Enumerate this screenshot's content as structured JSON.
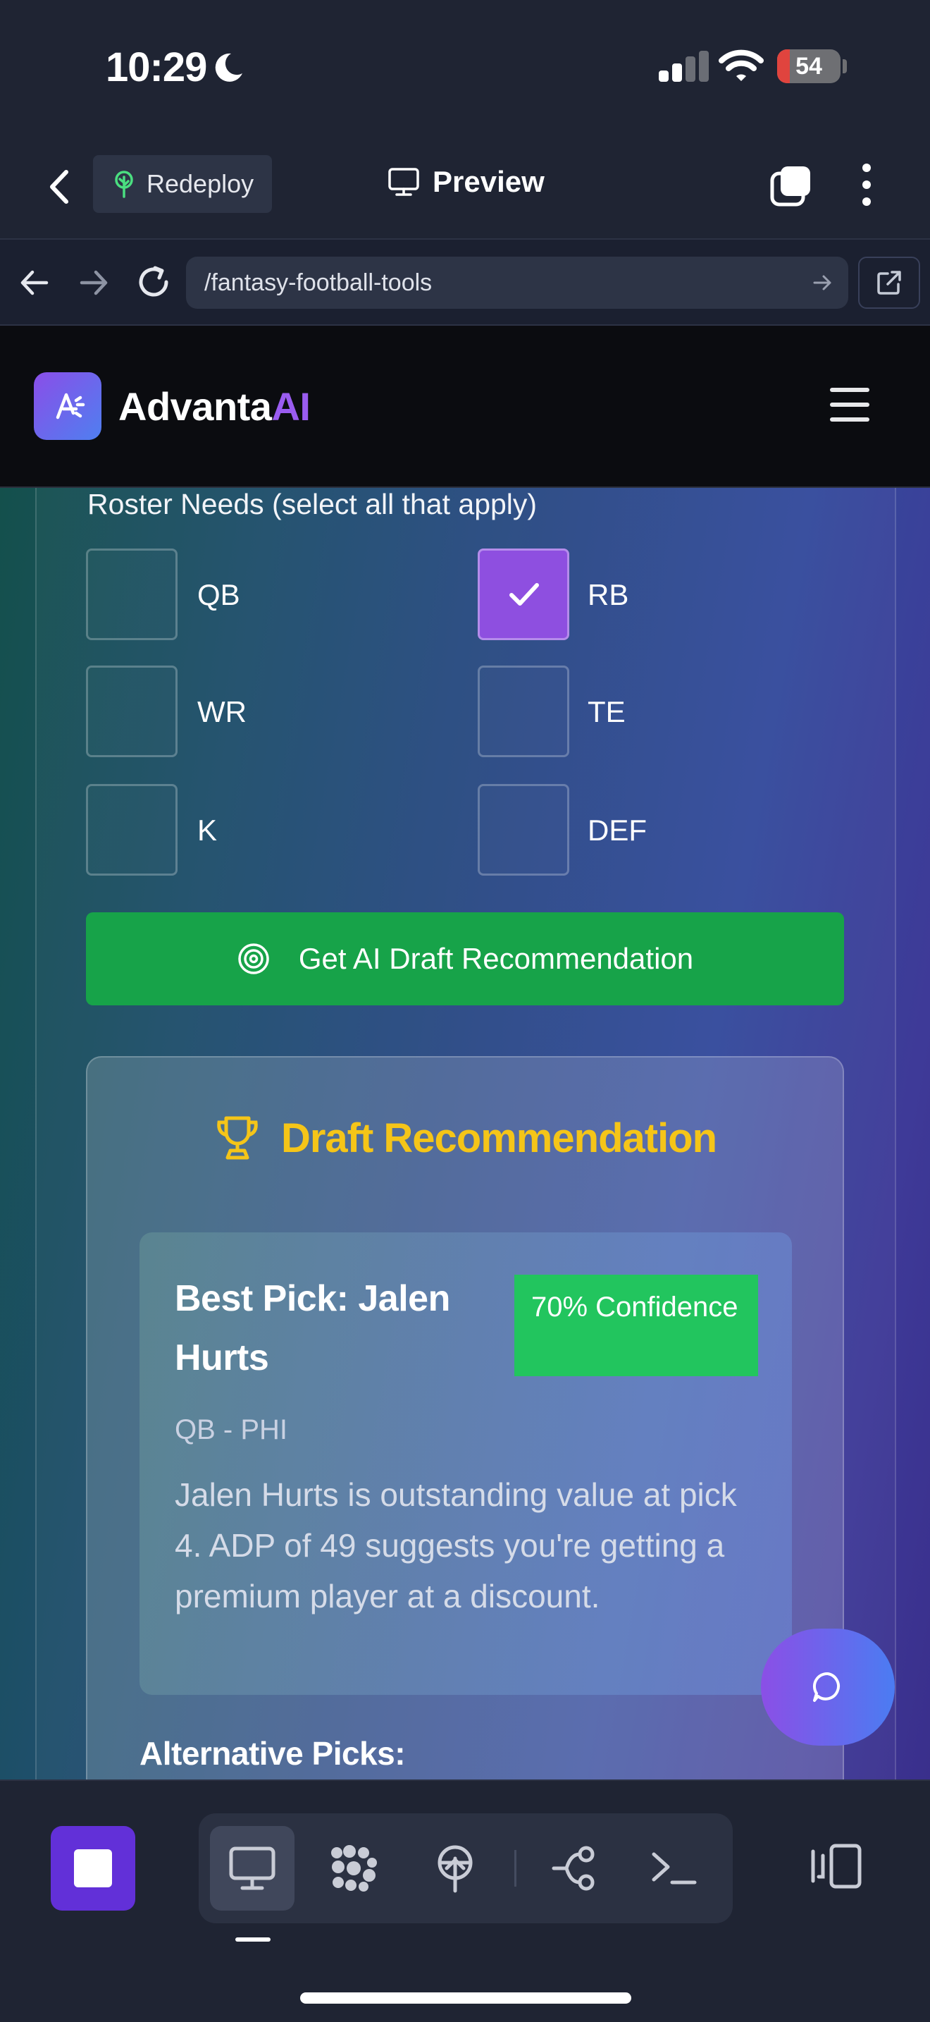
{
  "status_bar": {
    "time": "10:29",
    "battery": "54"
  },
  "topbar": {
    "redeploy_label": "Redeploy",
    "preview_label": "Preview"
  },
  "urlbar": {
    "path": "/fantasy-football-tools"
  },
  "site_header": {
    "brand_main": "Advanta",
    "brand_accent": "AI"
  },
  "roster": {
    "label": "Roster Needs (select all that apply)",
    "positions": [
      {
        "label": "QB",
        "checked": false
      },
      {
        "label": "RB",
        "checked": true
      },
      {
        "label": "WR",
        "checked": false
      },
      {
        "label": "TE",
        "checked": false
      },
      {
        "label": "K",
        "checked": false
      },
      {
        "label": "DEF",
        "checked": false
      }
    ]
  },
  "cta": {
    "label": "Get AI Draft Recommendation"
  },
  "recommendation": {
    "title": "Draft Recommendation",
    "pick_name": "Best Pick: Jalen Hurts",
    "confidence": "70% Confidence",
    "position_team": "QB - PHI",
    "description": "Jalen Hurts is outstanding value at pick 4. ADP of 49 suggests you're getting a premium player at a discount.",
    "alternatives_title": "Alternative Picks:"
  },
  "colors": {
    "accent_purple": "#8e4fe0",
    "cta_green": "#17a349",
    "confidence_green": "#22c55e",
    "trophy_gold": "#f5c518"
  },
  "icons": [
    "moon-icon",
    "signal-icon",
    "wifi-icon",
    "battery-icon",
    "chevron-left-icon",
    "tree-icon",
    "monitor-icon",
    "tabs-icon",
    "kebab-icon",
    "arrow-left-icon",
    "arrow-right-icon",
    "reload-icon",
    "external-link-icon",
    "logo-icon",
    "hamburger-icon",
    "check-icon",
    "target-icon",
    "trophy-icon",
    "chat-icon",
    "stop-icon",
    "apps-icon",
    "deploy-icon",
    "git-icon",
    "terminal-icon",
    "panel-toggle-icon"
  ]
}
